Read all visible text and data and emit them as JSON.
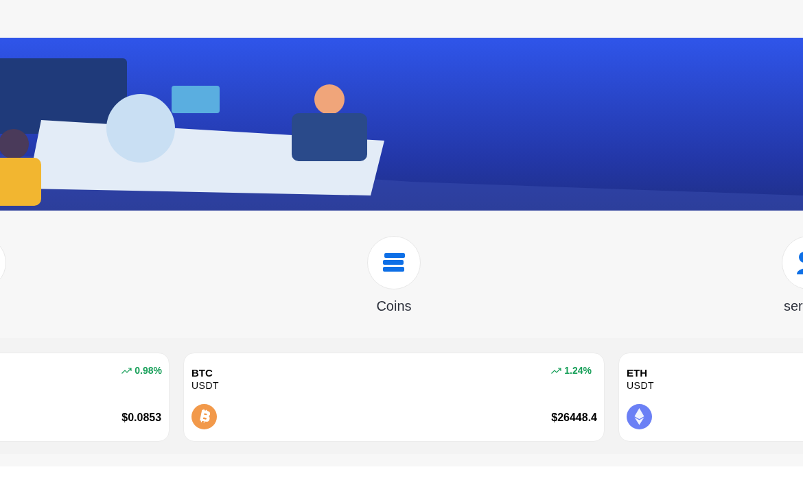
{
  "nav_items": [
    {
      "kind": "other"
    },
    {
      "kind": "coins",
      "label": "Coins"
    },
    {
      "kind": "person",
      "label": "ser"
    }
  ],
  "market_cards": [
    {
      "kind": "other",
      "change": "0.98%",
      "price": "$0.0853"
    },
    {
      "kind": "btc",
      "name": "BTC",
      "quote": "USDT",
      "change": "1.24%",
      "price": "$26448.4"
    },
    {
      "kind": "eth",
      "name": "ETH",
      "quote": "USDT"
    }
  ]
}
